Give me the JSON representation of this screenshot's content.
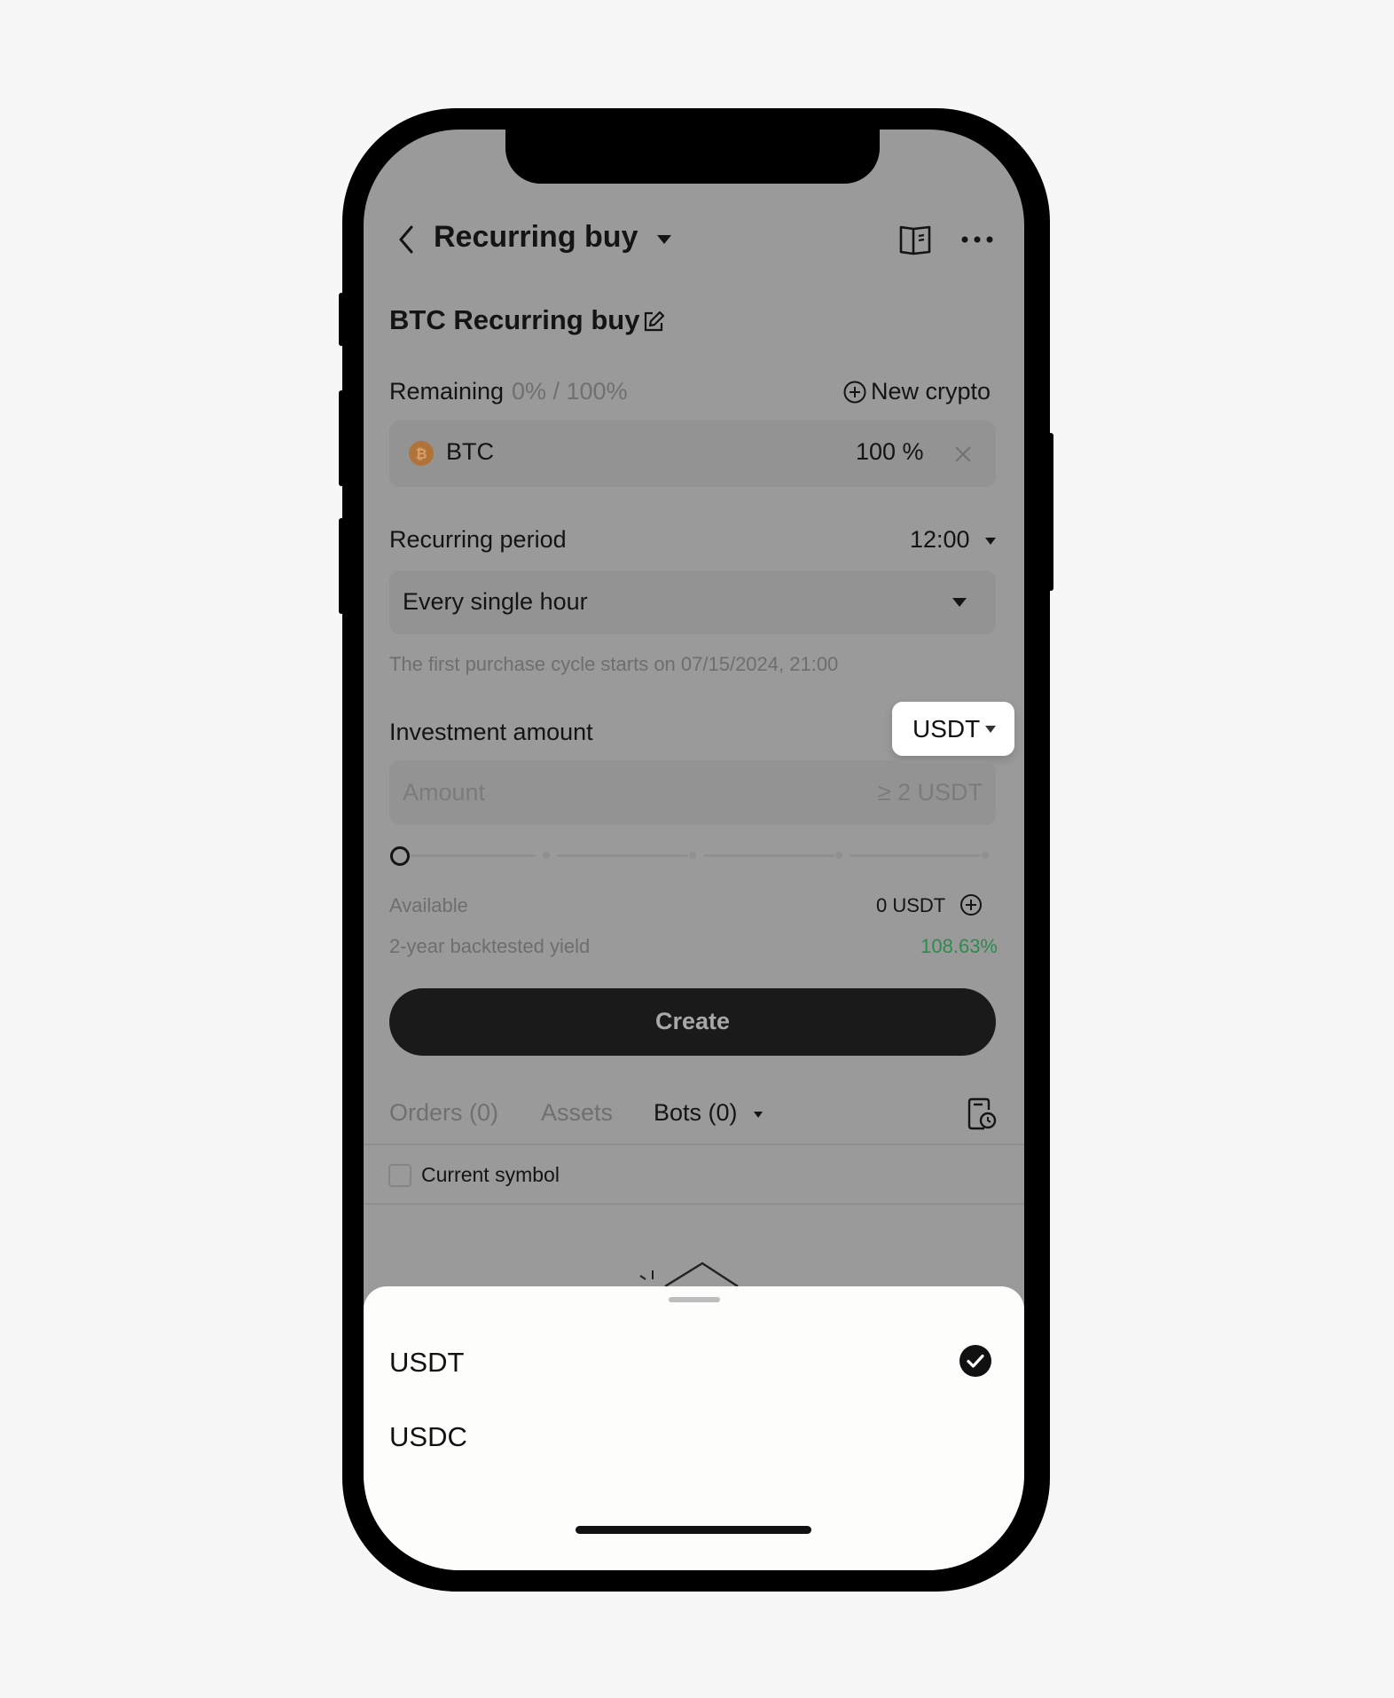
{
  "header": {
    "back_icon": "chevron-left-icon",
    "title": "Recurring buy",
    "title_dropdown_icon": "caret-down-icon",
    "guide_icon": "book-icon",
    "more_icon": "more-horizontal-icon"
  },
  "strategy": {
    "name": "BTC Recurring buy",
    "edit_icon": "edit-icon"
  },
  "allocation": {
    "label": "Remaining",
    "remaining_value": "0% / 100%",
    "new_crypto_label": "New crypto",
    "new_crypto_icon": "plus-circle-icon",
    "items": [
      {
        "coin": "BTC",
        "coin_icon": "bitcoin-icon",
        "percent": "100 %",
        "remove_icon": "close-icon"
      }
    ]
  },
  "period": {
    "label": "Recurring period",
    "time_value": "12:00",
    "frequency_value": "Every single hour",
    "note": "The first purchase cycle starts on 07/15/2024, 21:00"
  },
  "investment": {
    "label": "Investment amount",
    "currency_selected": "USDT",
    "amount_placeholder": "Amount",
    "amount_min_hint": "≥ 2 USDT",
    "slider_value_percent": 0,
    "available_label": "Available",
    "available_value": "0 USDT",
    "yield_label": "2-year backtested yield",
    "yield_value": "108.63%",
    "yield_color": "#2e8b4e"
  },
  "actions": {
    "create_label": "Create"
  },
  "tabs": {
    "items": [
      {
        "label": "Orders (0)",
        "active": false
      },
      {
        "label": "Assets",
        "active": false
      },
      {
        "label": "Bots (0)",
        "active": true
      }
    ],
    "history_icon": "order-history-icon"
  },
  "filter": {
    "current_symbol_label": "Current symbol",
    "current_symbol_checked": false
  },
  "currency_sheet": {
    "options": [
      {
        "label": "USDT",
        "selected": true
      },
      {
        "label": "USDC",
        "selected": false
      }
    ]
  }
}
